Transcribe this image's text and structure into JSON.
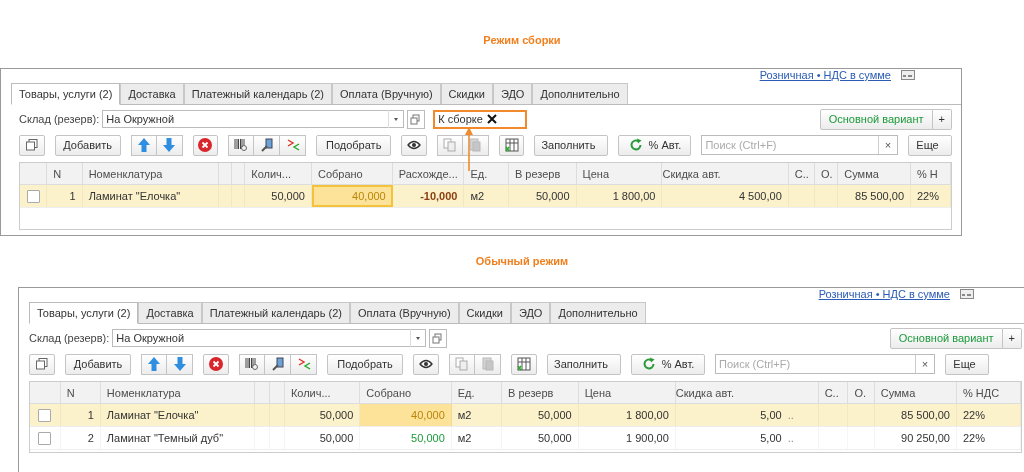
{
  "panels": [
    {
      "caption": "Режим сборки",
      "price_link": "Розничная • НДС в сумме",
      "tabs": [
        {
          "label": "Товары, услуги (2)",
          "selected": true
        },
        {
          "label": "Доставка",
          "selected": false
        },
        {
          "label": "Платежный календарь (2)",
          "selected": false
        },
        {
          "label": "Оплата (Вручную)",
          "selected": false
        },
        {
          "label": "Скидки",
          "selected": false
        },
        {
          "label": "ЭДО",
          "selected": false
        },
        {
          "label": "Дополнительно",
          "selected": false
        }
      ],
      "warehouse": {
        "label": "Склад (резерв):",
        "value": "На Окружной"
      },
      "filter": {
        "value": "К сборке",
        "highlighted": true
      },
      "variant": "Основной вариант",
      "variant_add": "+",
      "toolbar": {
        "add": "Добавить",
        "pick": "Подобрать",
        "fill": "Заполнить",
        "auto_discount": "% Авт.",
        "search_placeholder": "Поиск (Ctrl+F)",
        "search_clear": "×",
        "more": "Еще"
      },
      "columns": [
        {
          "kind": "check"
        },
        {
          "kind": "n",
          "label": "N"
        },
        {
          "kind": "name",
          "label": "Номенклатура"
        },
        {
          "kind": "blank"
        },
        {
          "kind": "blank"
        },
        {
          "kind": "qty",
          "label": "Колич..."
        },
        {
          "kind": "collected",
          "label": "Собрано"
        },
        {
          "kind": "diff",
          "label": "Расхожде..."
        },
        {
          "kind": "unit",
          "label": "Ед."
        },
        {
          "kind": "reserve",
          "label": "В резерв"
        },
        {
          "kind": "price",
          "label": "Цена"
        },
        {
          "kind": "discount",
          "label": "Скидка авт."
        },
        {
          "kind": "s",
          "label": "С.."
        },
        {
          "kind": "o",
          "label": "О."
        },
        {
          "kind": "sum",
          "label": "Сумма"
        },
        {
          "kind": "vat",
          "label": "% Н"
        }
      ],
      "rows": [
        {
          "selected": true,
          "checked": false,
          "n": "1",
          "name": "Ламинат \"Елочка\"",
          "qty": "50,000",
          "collected": "40,000",
          "partially_collected": true,
          "fully_collected": false,
          "diff": "-10,000",
          "unit": "м2",
          "reserve": "50,000",
          "price": "1 800,00",
          "discount": "4 500,00",
          "sum": "85 500,00",
          "vat": "22%"
        }
      ]
    },
    {
      "caption": "Обычный режим",
      "price_link": "Розничная • НДС в сумме",
      "tabs": [
        {
          "label": "Товары, услуги (2)",
          "selected": true
        },
        {
          "label": "Доставка",
          "selected": false
        },
        {
          "label": "Платежный календарь (2)",
          "selected": false
        },
        {
          "label": "Оплата (Вручную)",
          "selected": false
        },
        {
          "label": "Скидки",
          "selected": false
        },
        {
          "label": "ЭДО",
          "selected": false
        },
        {
          "label": "Дополнительно",
          "selected": false
        }
      ],
      "warehouse": {
        "label": "Склад (резерв):",
        "value": "На Окружной"
      },
      "variant": "Основной вариант",
      "variant_add": "+",
      "toolbar": {
        "add": "Добавить",
        "pick": "Подобрать",
        "fill": "Заполнить",
        "auto_discount": "% Авт.",
        "search_placeholder": "Поиск (Ctrl+F)",
        "search_clear": "×",
        "more": "Еще"
      },
      "columns": [
        {
          "kind": "check"
        },
        {
          "kind": "n",
          "label": "N"
        },
        {
          "kind": "name",
          "label": "Номенклатура"
        },
        {
          "kind": "blank"
        },
        {
          "kind": "blank"
        },
        {
          "kind": "qty",
          "label": "Колич..."
        },
        {
          "kind": "collected",
          "label": "Собрано"
        },
        {
          "kind": "unit",
          "label": "Ед."
        },
        {
          "kind": "reserve",
          "label": "В резерв"
        },
        {
          "kind": "price",
          "label": "Цена"
        },
        {
          "kind": "discount",
          "label": "Скидка авт."
        },
        {
          "kind": "s",
          "label": "С.."
        },
        {
          "kind": "o",
          "label": "О."
        },
        {
          "kind": "sum",
          "label": "Сумма"
        },
        {
          "kind": "vat",
          "label": "% НДС"
        }
      ],
      "rows": [
        {
          "selected": true,
          "checked": false,
          "n": "1",
          "name": "Ламинат \"Елочка\"",
          "qty": "50,000",
          "collected": "40,000",
          "partially_collected": true,
          "fully_collected": false,
          "unit": "м2",
          "reserve": "50,000",
          "price": "1 800,00",
          "discount": "5,00",
          "discount_extra": "..",
          "sum": "85 500,00",
          "vat": "22%"
        },
        {
          "selected": false,
          "checked": false,
          "n": "2",
          "name": "Ламинат \"Темный дуб\"",
          "qty": "50,000",
          "collected": "50,000",
          "partially_collected": false,
          "fully_collected": true,
          "unit": "м2",
          "reserve": "50,000",
          "price": "1 900,00",
          "discount": "5,00",
          "discount_extra": "..",
          "sum": "90 250,00",
          "vat": "22%"
        }
      ]
    }
  ]
}
